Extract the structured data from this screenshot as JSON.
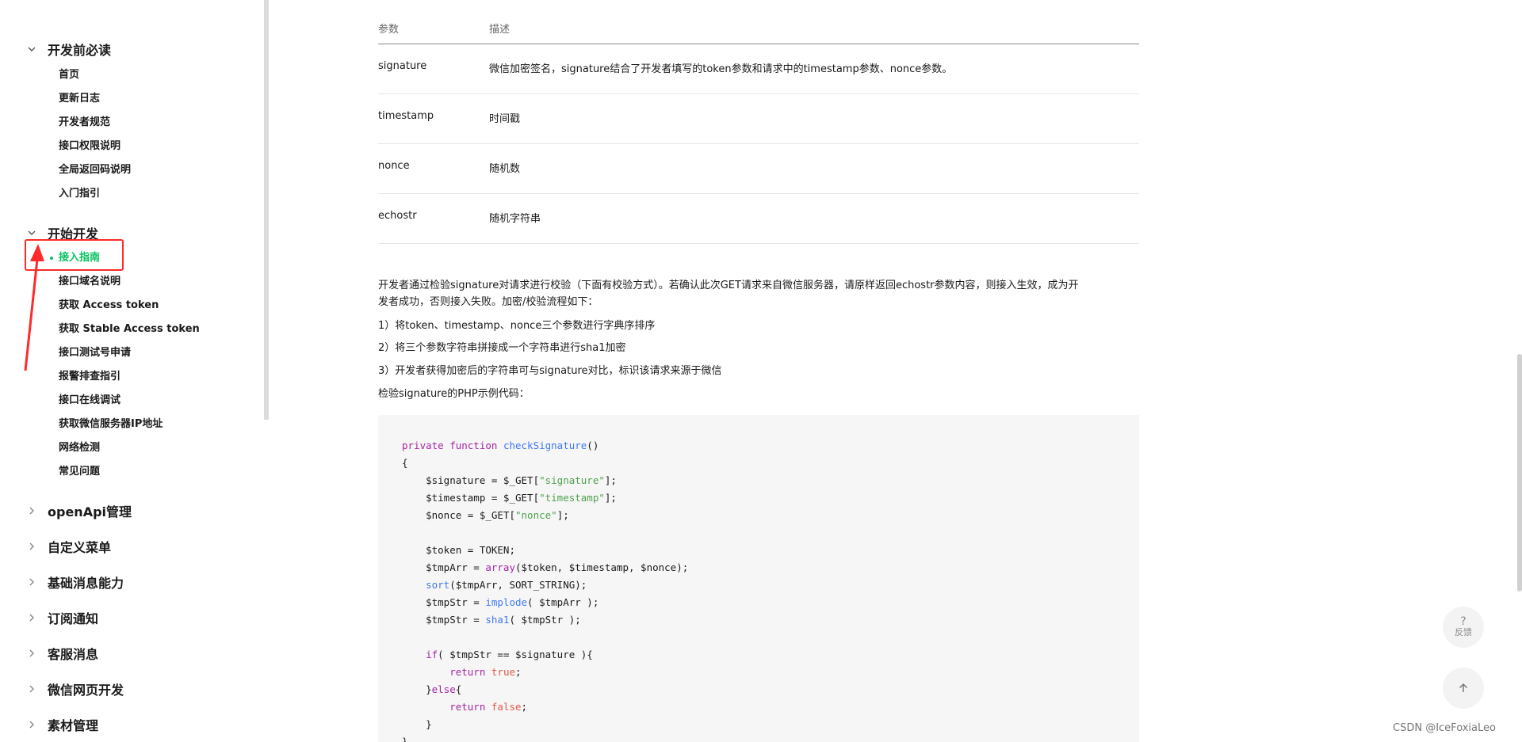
{
  "sidebar": {
    "sections": [
      {
        "label": "开发前必读",
        "expanded": true
      },
      {
        "label": "开始开发",
        "expanded": true
      },
      {
        "label": "openApi管理",
        "expanded": false
      },
      {
        "label": "自定义菜单",
        "expanded": false
      },
      {
        "label": "基础消息能力",
        "expanded": false
      },
      {
        "label": "订阅通知",
        "expanded": false
      },
      {
        "label": "客服消息",
        "expanded": false
      },
      {
        "label": "微信网页开发",
        "expanded": false
      },
      {
        "label": "素材管理",
        "expanded": false
      }
    ],
    "group1_items": [
      "首页",
      "更新日志",
      "开发者规范",
      "接口权限说明",
      "全局返回码说明",
      "入门指引"
    ],
    "group2_items": [
      "接入指南",
      "接口域名说明",
      "获取 Access token",
      "获取 Stable Access token",
      "接口测试号申请",
      "报警排查指引",
      "接口在线调试",
      "获取微信服务器IP地址",
      "网络检测",
      "常见问题"
    ],
    "active_item": "接入指南"
  },
  "table": {
    "headers": [
      "参数",
      "描述"
    ],
    "rows": [
      [
        "signature",
        "微信加密签名，signature结合了开发者填写的token参数和请求中的timestamp参数、nonce参数。"
      ],
      [
        "timestamp",
        "时间戳"
      ],
      [
        "nonce",
        "随机数"
      ],
      [
        "echostr",
        "随机字符串"
      ]
    ]
  },
  "paragraphs": {
    "intro_line1": "开发者通过检验signature对请求进行校验（下面有校验方式）。若确认此次GET请求来自微信服务器，请原样返回echostr参数内容，则接入生效，成为开",
    "intro_line2": "发者成功，否则接入失败。加密/校验流程如下：",
    "step1": "1）将token、timestamp、nonce三个参数进行字典序排序",
    "step2": "2）将三个参数字符串拼接成一个字符串进行sha1加密",
    "step3": "3）开发者获得加密后的字符串可与signature对比，标识该请求来源于微信",
    "code_intro": "检验signature的PHP示例代码："
  },
  "code": {
    "l1_kw": "private function ",
    "l1_fn": "checkSignature",
    "l1_rest": "()",
    "l2": "{",
    "l3a": "    $signature = $_GET[",
    "l3s": "\"signature\"",
    "l3b": "];",
    "l4a": "    $timestamp = $_GET[",
    "l4s": "\"timestamp\"",
    "l4b": "];",
    "l5a": "    $nonce = $_GET[",
    "l5s": "\"nonce\"",
    "l5b": "];",
    "l6": "    $token = TOKEN;",
    "l7a": "    $tmpArr = ",
    "l7k": "array",
    "l7b": "($token, $timestamp, $nonce);",
    "l8k": "    sort",
    "l8b": "($tmpArr, SORT_STRING);",
    "l9a": "    $tmpStr = ",
    "l9k": "implode",
    "l9b": "( $tmpArr );",
    "l10a": "    $tmpStr = ",
    "l10k": "sha1",
    "l10b": "( $tmpStr );",
    "l11k": "    if",
    "l11b": "( $tmpStr == $signature ){",
    "l12k": "        return ",
    "l12l": "true",
    "l12b": ";",
    "l13a": "    }",
    "l13k": "else",
    "l13b": "{",
    "l14k": "        return ",
    "l14l": "false",
    "l14b": ";",
    "l15": "    }",
    "l16": "}"
  },
  "floating": {
    "feedback_icon": "?",
    "feedback_label": "反馈",
    "top_icon": "arrow-up-icon"
  },
  "watermark": "CSDN @IceFoxiaLeo",
  "colors": {
    "accent": "#07c160",
    "annotation": "#ff2a2a"
  }
}
